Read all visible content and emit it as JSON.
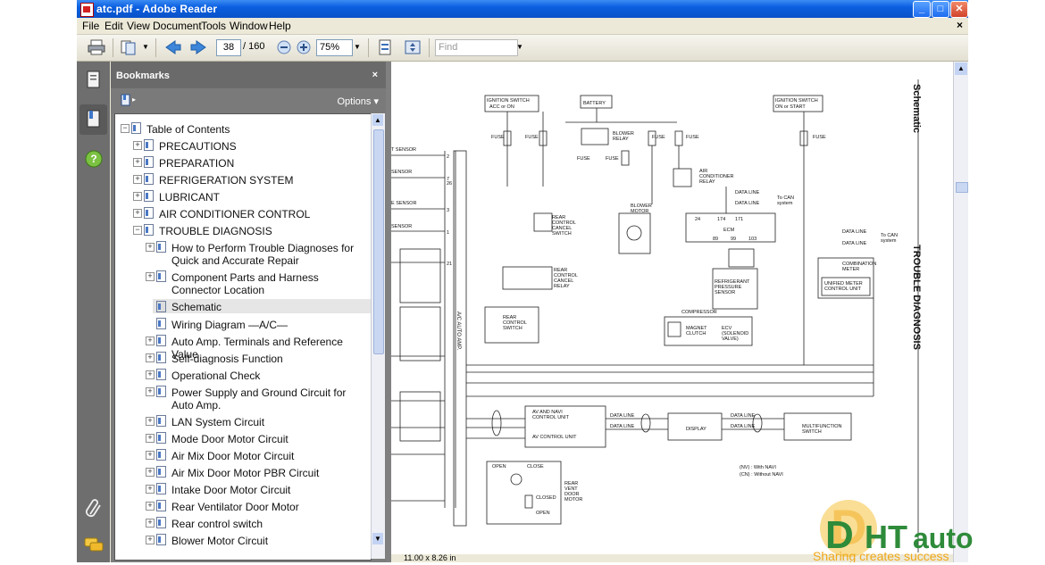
{
  "window": {
    "title": "atc.pdf - Adobe Reader"
  },
  "menu": [
    "File",
    "Edit",
    "View",
    "Document",
    "Tools",
    "Window",
    "Help"
  ],
  "toolbar": {
    "page_current": "38",
    "page_total": "/ 160",
    "zoom": "75%",
    "find_placeholder": "Find"
  },
  "bookmarks": {
    "title": "Bookmarks",
    "close": "×",
    "options": "Options ▾",
    "items": [
      {
        "label": "Table of Contents"
      },
      {
        "label": "PRECAUTIONS"
      },
      {
        "label": "PREPARATION"
      },
      {
        "label": "REFRIGERATION SYSTEM"
      },
      {
        "label": "LUBRICANT"
      },
      {
        "label": "AIR CONDITIONER CONTROL"
      },
      {
        "label": "TROUBLE DIAGNOSIS"
      },
      {
        "label": "How to Perform Trouble Diagnoses for Quick and Accurate Repair"
      },
      {
        "label": "Component Parts and Harness Connector Location"
      },
      {
        "label": "Schematic"
      },
      {
        "label": "Wiring Diagram —A/C—"
      },
      {
        "label": "Auto Amp. Terminals and Reference Value"
      },
      {
        "label": "Self-diagnosis Function"
      },
      {
        "label": "Operational Check"
      },
      {
        "label": "Power Supply and Ground Circuit for Auto Amp."
      },
      {
        "label": "LAN System Circuit"
      },
      {
        "label": "Mode Door Motor Circuit"
      },
      {
        "label": "Air Mix Door Motor Circuit"
      },
      {
        "label": "Air Mix Door Motor PBR Circuit"
      },
      {
        "label": "Intake Door Motor Circuit"
      },
      {
        "label": "Rear Ventilator Door Motor"
      },
      {
        "label": "Rear control switch"
      },
      {
        "label": "Blower Motor Circuit"
      }
    ]
  },
  "document": {
    "side_title": "Schematic",
    "side_section": "TROUBLE DIAGNOSIS",
    "page_size": "11.00 x 8.26 in",
    "labels": {
      "ign_acc": "IGNITION SWITCH ACC or ON",
      "battery": "BATTERY",
      "ign_on": "IGNITION SWITCH ON or START",
      "fuse": "FUSE",
      "blower_relay": "BLOWER RELAY",
      "ac_relay": "AIR CONDITIONER RELAY",
      "data_line": "DATA LINE",
      "to_can": "To CAN system",
      "ecm": "ECM",
      "rear_cancel_sw": "REAR CONTROL CANCEL SWITCH",
      "blower_motor": "BLOWER MOTOR",
      "rear_cancel_relay": "REAR CONTROL CANCEL RELAY",
      "refrig_sensor": "REFRIGERANT PRESSURE SENSOR",
      "combination_meter": "COMBINATION METER",
      "unified_meter": "UNIFIED METER CONTROL UNIT",
      "compressor": "COMPRESSOR",
      "magnet_clutch": "MAGNET CLUTCH",
      "ecv": "ECV (SOLENOID VALVE)",
      "rear_control_sw": "REAR CONTROL SWITCH",
      "av_navi": "AV AND NAVI CONTROL UNIT",
      "av_control": "AV CONTROL UNIT",
      "display": "DISPLAY",
      "multifunction": "MULTIFUNCTION SWITCH",
      "open": "OPEN",
      "close": "CLOSE",
      "closed": "CLOSED",
      "rear_vent": "REAR VENT DOOR MOTOR",
      "with_navi": "(NV) : With NAVI",
      "without_navi": "(CN) : Without NAVI",
      "ac_auto_amp": "A/C AUTO AMP.",
      "sensor": "SENSOR"
    }
  },
  "watermark": {
    "brand": "DHT auto",
    "tagline": "Sharing creates success"
  },
  "colors": {
    "title_bar": "#0b5fe0",
    "panel": "#7d7d7d",
    "accent": "#4a78c4"
  }
}
